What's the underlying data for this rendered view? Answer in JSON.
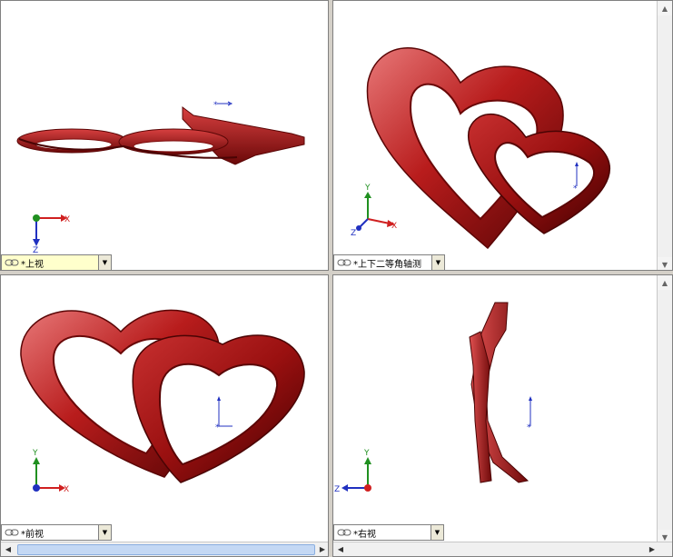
{
  "viewports": {
    "top": {
      "label": "*上视"
    },
    "iso": {
      "label": "*上下二等角轴测"
    },
    "front": {
      "label": "*前视"
    },
    "right": {
      "label": "*右视"
    }
  },
  "axes": {
    "x": "X",
    "y": "Y",
    "z": "Z"
  },
  "colors": {
    "model": "#b01818",
    "model_dark": "#5a0606",
    "x_axis": "#d02020",
    "y_axis": "#209020",
    "z_axis": "#2030c0"
  },
  "icons": {
    "link": "link-icon",
    "dropdown": "chevron-down-icon"
  }
}
